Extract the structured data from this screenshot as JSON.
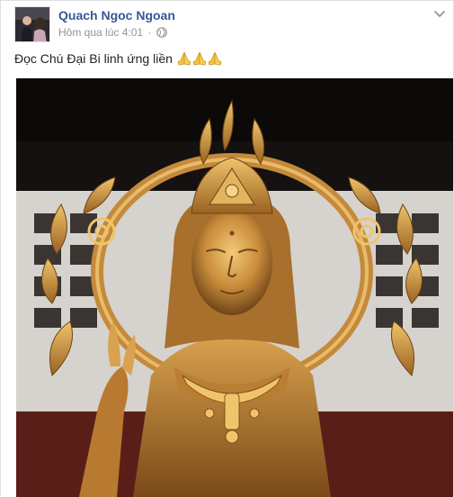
{
  "post": {
    "author": "Quach Ngoc Ngoan",
    "timestamp": "Hôm qua lúc 4:01",
    "separator": "·",
    "privacy_icon": "globe-icon",
    "menu_icon": "chevron-down-icon",
    "text": "Đọc Chú Đại Bi linh ứng liền",
    "emoji": [
      "folded-hands-icon",
      "folded-hands-icon",
      "folded-hands-icon"
    ]
  },
  "colors": {
    "author_link": "#365899",
    "meta_text": "#90949c",
    "emoji_yellow": "#f5c33b"
  }
}
